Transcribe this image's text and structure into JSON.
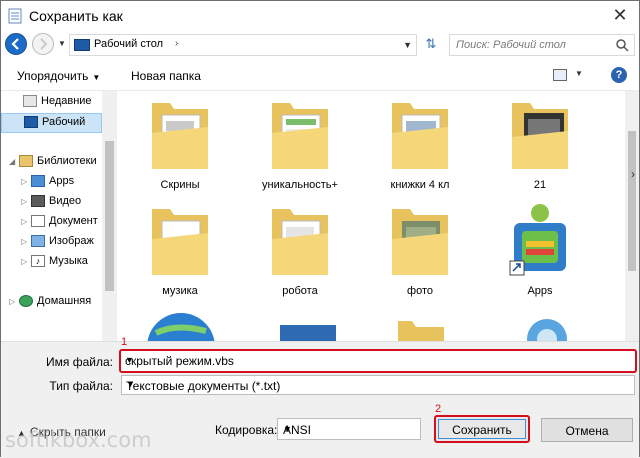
{
  "window": {
    "title": "Сохранить как",
    "close_glyph": "✕"
  },
  "nav": {
    "address": "Рабочий стол",
    "address_chevron": "›",
    "search_placeholder": "Поиск: Рабочий стол"
  },
  "toolbar": {
    "organize_label": "Упорядочить",
    "new_folder_label": "Новая папка",
    "help_label": "?"
  },
  "sidebar": {
    "items": [
      {
        "label": "Недавние",
        "icon": "recent-icon"
      },
      {
        "label": "Рабочий",
        "icon": "desktop-icon"
      },
      {
        "label": "Библиотеки",
        "icon": "libraries-icon"
      },
      {
        "label": "Apps",
        "icon": "apps-icon"
      },
      {
        "label": "Видео",
        "icon": "video-icon"
      },
      {
        "label": "Документ",
        "icon": "document-icon"
      },
      {
        "label": "Изображ",
        "icon": "image-icon"
      },
      {
        "label": "Музыка",
        "icon": "music-icon"
      },
      {
        "label": "Домашняя",
        "icon": "homegroup-icon"
      }
    ]
  },
  "files": [
    {
      "label": "Скрины",
      "icon": "folder-icon"
    },
    {
      "label": "уникальность+",
      "icon": "folder-icon"
    },
    {
      "label": "книжки 4 кл",
      "icon": "folder-icon"
    },
    {
      "label": "21",
      "icon": "folder-icon"
    },
    {
      "label": "музика",
      "icon": "folder-icon"
    },
    {
      "label": "робота",
      "icon": "folder-icon"
    },
    {
      "label": "фото",
      "icon": "folder-icon"
    },
    {
      "label": "Apps",
      "icon": "bluestacks-shortcut-icon"
    }
  ],
  "form": {
    "filename_label": "Имя файла:",
    "filename_value": "скрытый режим.vbs",
    "filetype_label": "Тип файла:",
    "filetype_value": "Текстовые документы (*.txt)",
    "hide_folders_label": "Скрыть папки",
    "encoding_label": "Кодировка:",
    "encoding_value": "ANSI",
    "save_label": "Сохранить",
    "cancel_label": "Отмена",
    "annotation_1": "1",
    "annotation_2": "2"
  },
  "watermark": {
    "text": "softikbox.com"
  },
  "colors": {
    "highlight_red": "#d40e1e",
    "selection_blue": "#cce4f7",
    "folder_yellow": "#f5d77a"
  }
}
